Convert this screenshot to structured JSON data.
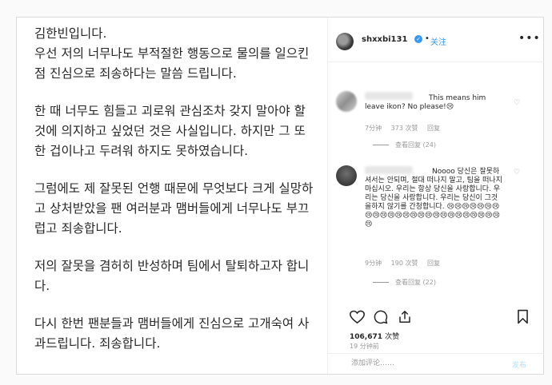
{
  "post": {
    "paragraphs": [
      "김한빈입니다.\n우선 저의 너무나도 부적절한 행동으로 물의를 일으킨 점 진심으로 죄송하다는 말씀 드립니다.",
      "한 때 너무도 힘들고 괴로워 관심조차 갖지 말아야 할 것에 의지하고 싶었던 것은 사실입니다. 하지만 그 또한 겁이나고 두려워 하지도 못하였습니다.",
      "그럼에도 제 잘못된 언행 때문에 무엇보다 크게 실망하고 상처받았을 팬 여러분과 맴버들에게 너무나도 부끄럽고 죄송합니다.",
      "저의 잘못을 겸허히 반성하며 팀에서 탈퇴하고자 합니다.",
      "다시 한번 팬분들과 맴버들에게 진심으로 고개숙여 사과드립니다. 죄송합니다."
    ]
  },
  "header": {
    "username": "shxxbi131",
    "separator": "•",
    "follow_label": "关注",
    "more_label": "•••"
  },
  "comments": [
    {
      "text": "This means him leave ikon? No please!😢",
      "time": "7分钟",
      "likes": "373 次赞",
      "reply": "回复",
      "view_replies": "查看回复 (24)"
    },
    {
      "text": "Noooo 당신은 잘못하셔서는 안되며, 절대 떠나지 말고, 팀을 떠나지 마십시오. 우리는 항상 당신을 사랑합니다. 우리는 당신을 사랑합니다. 우리는 당신이 그것을하지 않기를 간청합니다. 😢😢😢😢😢😢😢😢😢😢😢😢😢😢😢😢😢😢😢😢😢😢😢😢😢😢",
      "time": "9分钟",
      "likes": "190 次赞",
      "reply": "回复",
      "view_replies": "查看回复 (22)"
    }
  ],
  "stats": {
    "likes_count": "106,671",
    "likes_label": "次赞",
    "time_ago": "19 分钟前"
  },
  "comment_box": {
    "placeholder": "添加评论……",
    "post_label": "发布"
  },
  "colors": {
    "accent": "#3897f0",
    "muted": "#999999",
    "post_disabled": "#b2dffc"
  },
  "icons": {
    "like": "heart-icon",
    "comment": "comment-bubble-icon",
    "share": "share-icon",
    "save": "bookmark-icon"
  }
}
